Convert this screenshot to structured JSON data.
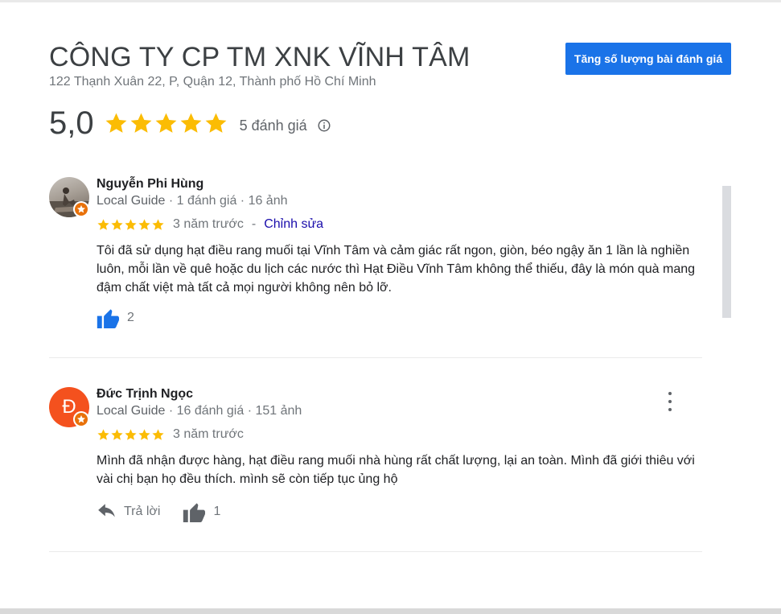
{
  "business": {
    "name": "CÔNG TY CP TM XNK VĨNH TÂM",
    "address": "122 Thạnh Xuân 22, P, Quận 12, Thành phố Hồ Chí Minh",
    "cta_label": "Tăng số lượng bài đánh giá",
    "rating_score": "5,0",
    "rating_stars": 5,
    "review_count_label": "5 đánh giá"
  },
  "colors": {
    "star": "#fbbc04",
    "primary_blue": "#1a73e8",
    "link": "#1a0dab",
    "avatar_letter_bg": "#f4511e",
    "local_guide_badge": "#e8710a"
  },
  "icons": {
    "info": "info-circle-icon",
    "thumb": "thumb-up-icon",
    "reply": "reply-arrow-icon",
    "more": "more-vert-icon",
    "star": "star-icon"
  },
  "reviews": [
    {
      "name": "Nguyễn Phi Hùng",
      "guide": "Local Guide",
      "meta_sep": " · ",
      "review_count": "1 đánh giá",
      "photo_count": "16 ảnh",
      "stars": 5,
      "time": "3 năm trước",
      "separator": "-",
      "edit_label": "Chỉnh sửa",
      "text": "Tôi đã sử dụng hạt điều rang muối tại Vĩnh Tâm và cảm giác rất ngon, giòn, béo ngậy ăn 1 lần là nghiền luôn, mỗi lần về quê hoặc du lịch các nước thì Hạt Điều Vĩnh Tâm không thể thiếu, đây là món quà mang đậm chất việt mà tất cả mọi người không nên bỏ lỡ.",
      "likes": "2"
    },
    {
      "name": "Đức Trịnh Ngọc",
      "avatar_letter": "Đ",
      "guide": "Local Guide",
      "meta_sep": " · ",
      "review_count": "16 đánh giá",
      "photo_count": "151 ảnh",
      "stars": 5,
      "time": "3 năm trước",
      "text": "Mình đã nhận được hàng, hạt điều rang muối nhà hùng rất chất lượng, lại an toàn. Mình đã giới thiêu với vài chị bạn họ đều thích. mình sẽ còn tiếp tục ủng hộ",
      "reply_label": "Trả lời",
      "likes": "1"
    }
  ]
}
